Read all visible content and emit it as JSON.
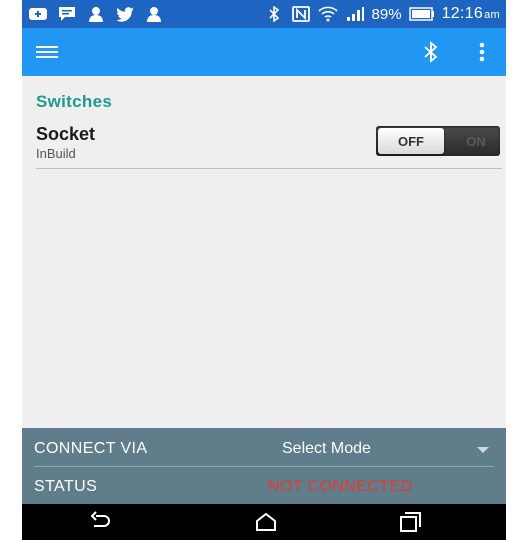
{
  "status_bar": {
    "battery": "89%",
    "time": "12:16",
    "ampm": "am",
    "icons": [
      "notification-icon",
      "message-icon",
      "hangouts-icon",
      "twitter-icon",
      "hangouts-icon",
      "bluetooth-icon",
      "nfc-icon",
      "wifi-icon",
      "signal-icon",
      "battery-icon"
    ]
  },
  "app_bar": {
    "color": "#2196f3",
    "icons": [
      "menu-icon",
      "bluetooth-icon",
      "more-vert-icon"
    ]
  },
  "section": {
    "title": "Switches",
    "title_color": "#1f9b8c"
  },
  "item": {
    "title": "Socket",
    "subtitle": "InBuild",
    "toggle": {
      "off_label": "OFF",
      "on_label": "ON",
      "state": "off"
    }
  },
  "bottom_panel": {
    "background": "#607d8b",
    "connect_label": "CONNECT VIA",
    "select_value": "Select Mode",
    "status_label": "STATUS",
    "status_value": "NOT CONNECTED",
    "status_color": "#e53935"
  },
  "nav_bar": {
    "icons": [
      "back-icon",
      "home-icon",
      "recents-icon"
    ]
  }
}
